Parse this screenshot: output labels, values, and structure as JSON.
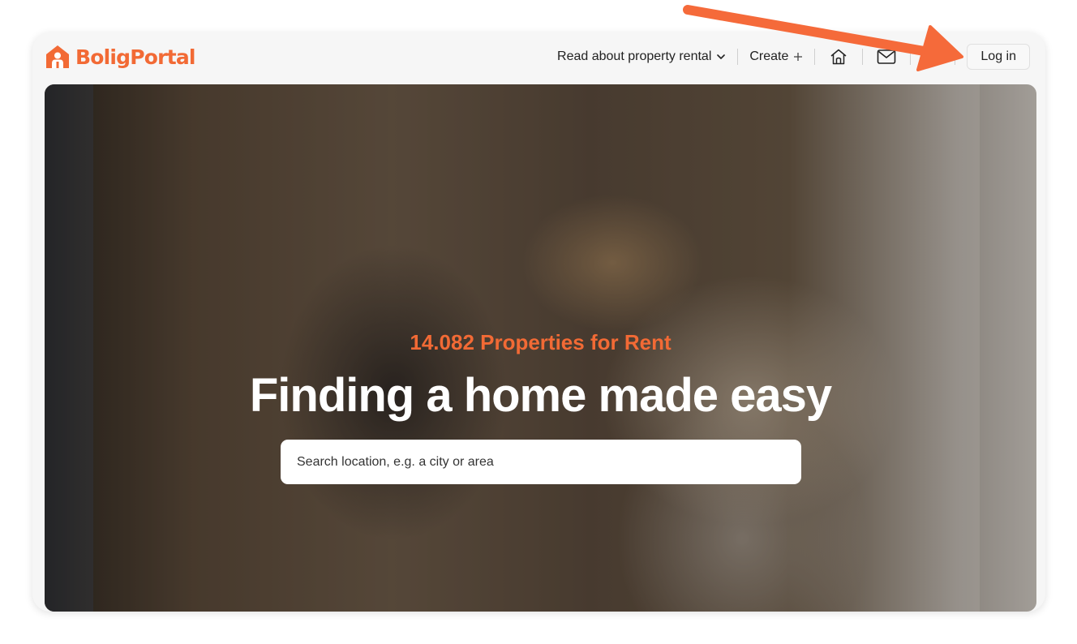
{
  "brand": {
    "name": "BoligPortal",
    "color": "#f26a35"
  },
  "nav": {
    "read_about": "Read about property rental",
    "create": "Create",
    "home_icon": "home-icon",
    "mail_icon": "mail-icon",
    "login": "Log in"
  },
  "hero": {
    "count_text": "14.082 Properties for Rent",
    "headline": "Finding a home made easy",
    "search_placeholder": "Search location, e.g. a city or area"
  },
  "annotation": {
    "arrow_color": "#f56a3a"
  }
}
